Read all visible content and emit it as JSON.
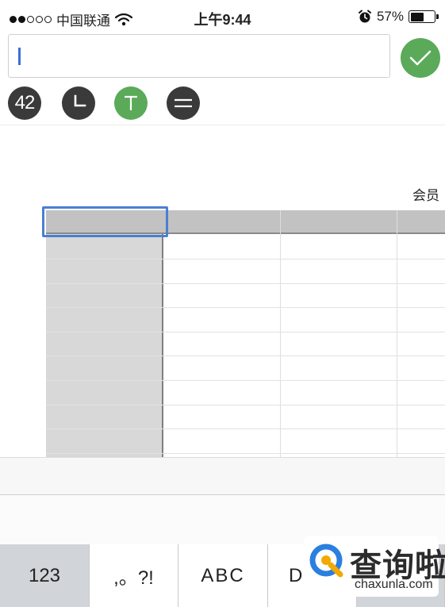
{
  "status_bar": {
    "carrier": "中国联通",
    "time": "上午9:44",
    "battery": "57%",
    "battery_level": 0.57,
    "signal_strength": 2
  },
  "input": {
    "value": "",
    "placeholder": ""
  },
  "toolbar": {
    "number_badge": "42",
    "icons": [
      "number-badge-icon",
      "clock-icon",
      "text-icon",
      "align-icon",
      "checkmark-icon"
    ],
    "accent_color": "#5aaa5a"
  },
  "sheet": {
    "title": "会员"
  },
  "keyboard": {
    "keys": [
      "123",
      ",。?!",
      "ABC",
      "D"
    ]
  },
  "watermark": {
    "brand_cn": "查询啦",
    "brand_en": "chaxunla.com",
    "color": "#2a7fe0"
  }
}
